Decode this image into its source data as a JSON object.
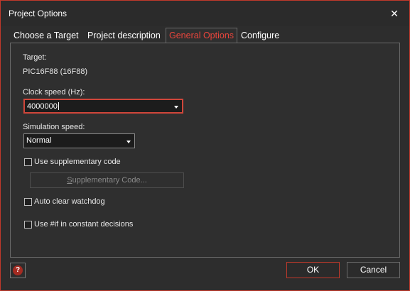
{
  "window": {
    "title": "Project Options",
    "close_glyph": "✕",
    "close_icon": "close-icon"
  },
  "tabs": [
    {
      "label": "Choose a Target"
    },
    {
      "label": "Project description"
    },
    {
      "label": "General Options",
      "selected": true
    },
    {
      "label": "Configure"
    }
  ],
  "general": {
    "target_label": "Target:",
    "target_value": "PIC16F88 (16F88)",
    "clock_label": "Clock speed (Hz):",
    "clock_value": "4000000",
    "simulation_label": "Simulation speed:",
    "simulation_value": "Normal",
    "use_supplementary": {
      "label": "Use supplementary code",
      "checked": false
    },
    "supplementary_button": {
      "label_underlined": "S",
      "label_rest": "upplementary Code...",
      "enabled": false
    },
    "auto_clear_watchdog": {
      "label": "Auto clear watchdog",
      "checked": false
    },
    "use_if_constant": {
      "label": "Use #if in constant decisions",
      "checked": false
    }
  },
  "footer": {
    "help_glyph": "?",
    "help_icon": "help-icon",
    "ok_label": "OK",
    "cancel_label": "Cancel"
  },
  "colors": {
    "accent": "#d0463a",
    "background": "#2d2d2d",
    "field_background": "#1c1c1c",
    "text": "#e6e6e6"
  }
}
